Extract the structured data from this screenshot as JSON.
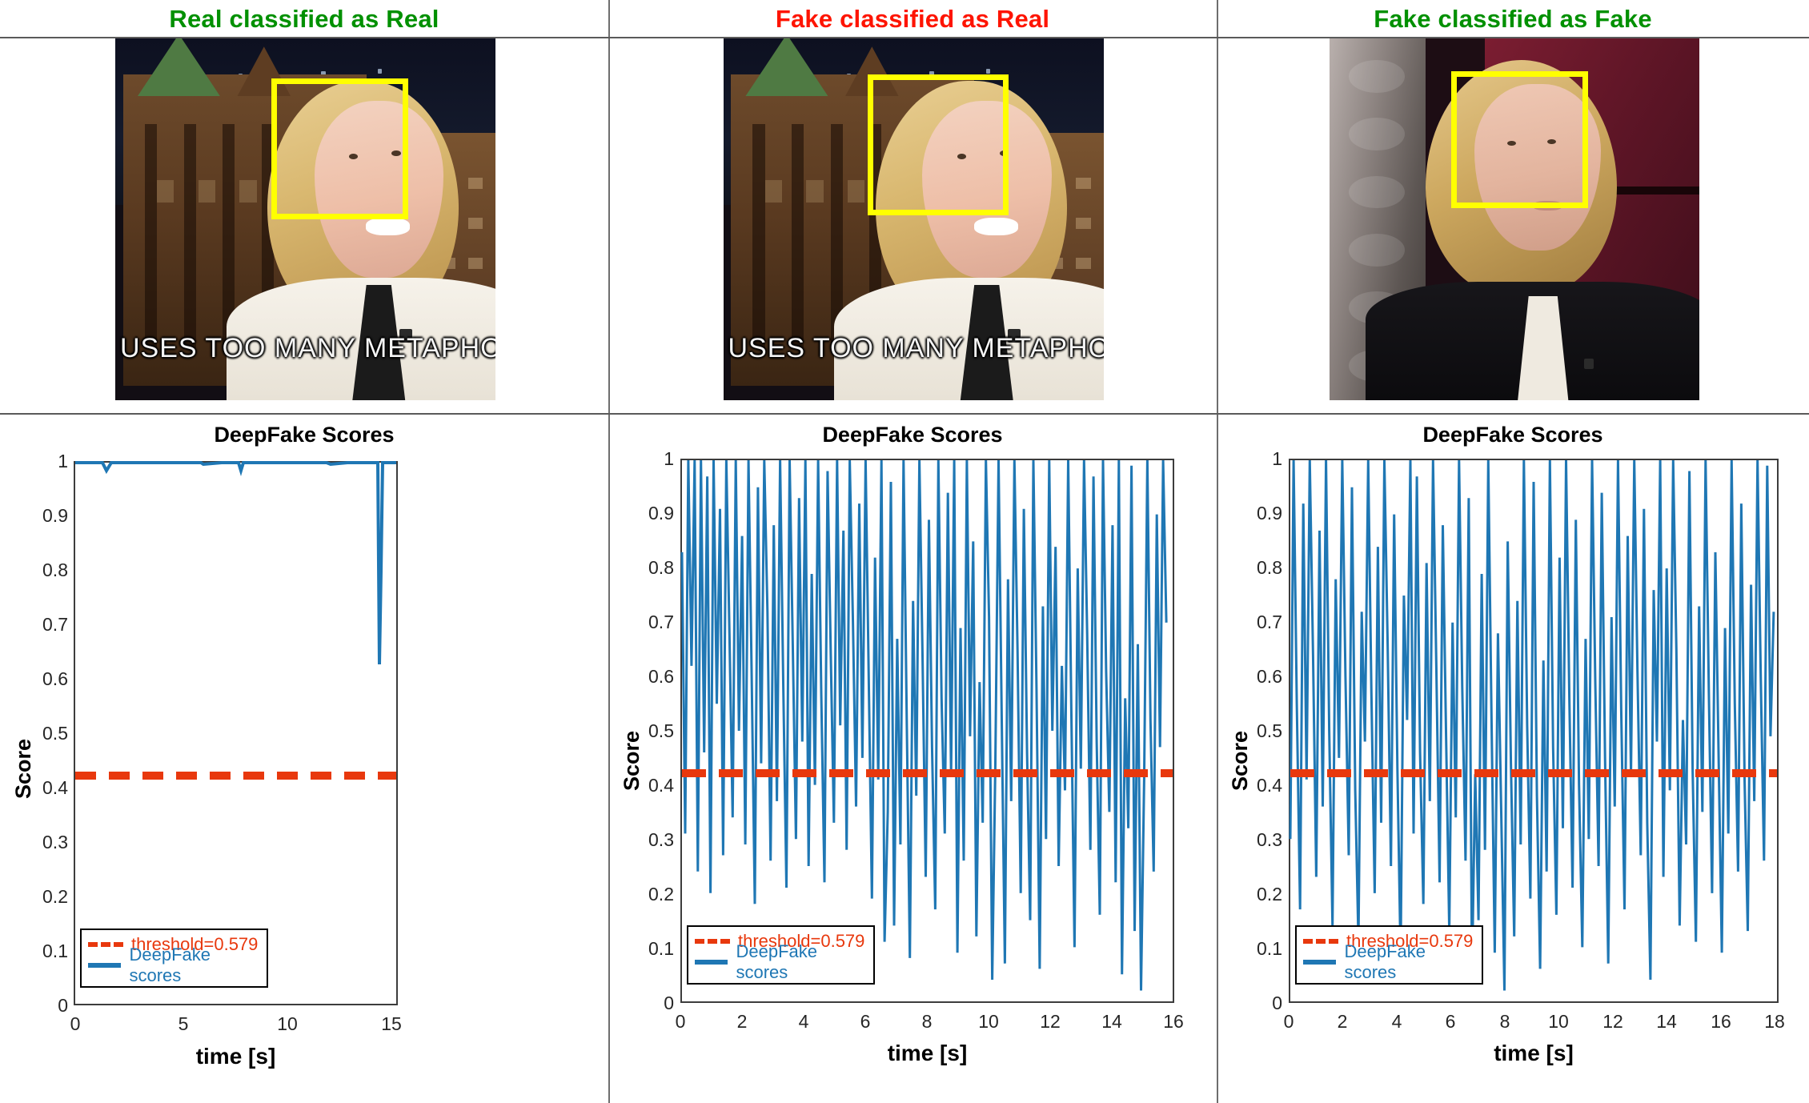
{
  "panels": [
    {
      "header": {
        "text": "Real classified as Real",
        "color": "#009000"
      },
      "caption": "USES TOO MANY METAPHO",
      "bbox_label": "face-bounding-box",
      "chart": {
        "title": "DeepFake Scores",
        "xlabel": "time [s]",
        "ylabel": "Score",
        "xticks": [
          "0",
          "5",
          "10",
          "15"
        ],
        "yticks": [
          "0",
          "0.1",
          "0.2",
          "0.3",
          "0.4",
          "0.5",
          "0.6",
          "0.7",
          "0.8",
          "0.9",
          "1"
        ],
        "legend": {
          "threshold": "threshold=0.579",
          "series": "DeepFake scores"
        }
      }
    },
    {
      "header": {
        "text": "Fake classified as Real",
        "color": "#fe1400"
      },
      "caption": "USES TOO MANY METAPHO",
      "bbox_label": "face-bounding-box",
      "chart": {
        "title": "DeepFake Scores",
        "xlabel": "time [s]",
        "ylabel": "Score",
        "xticks": [
          "0",
          "2",
          "4",
          "6",
          "8",
          "10",
          "12",
          "14",
          "16"
        ],
        "yticks": [
          "0",
          "0.1",
          "0.2",
          "0.3",
          "0.4",
          "0.5",
          "0.6",
          "0.7",
          "0.8",
          "0.9",
          "1"
        ],
        "legend": {
          "threshold": "threshold=0.579",
          "series": "DeepFake scores"
        }
      }
    },
    {
      "header": {
        "text": "Fake classified as Fake",
        "color": "#009000"
      },
      "caption": "",
      "bbox_label": "face-bounding-box",
      "chart": {
        "title": "DeepFake Scores",
        "xlabel": "time [s]",
        "ylabel": "Score",
        "xticks": [
          "0",
          "2",
          "4",
          "6",
          "8",
          "10",
          "12",
          "14",
          "16",
          "18"
        ],
        "yticks": [
          "0",
          "0.1",
          "0.2",
          "0.3",
          "0.4",
          "0.5",
          "0.6",
          "0.7",
          "0.8",
          "0.9",
          "1"
        ],
        "legend": {
          "threshold": "threshold=0.579",
          "series": "DeepFake scores"
        }
      }
    }
  ],
  "colors": {
    "series_blue": "#1f77b4",
    "threshold_red": "#e8380d",
    "bbox_yellow": "#ffff00",
    "header_green": "#009000",
    "header_red": "#fe1400"
  },
  "chart_data": [
    {
      "type": "line",
      "title": "DeepFake Scores",
      "xlabel": "time [s]",
      "ylabel": "Score",
      "xlim": [
        0,
        15.6
      ],
      "ylim": [
        0,
        1
      ],
      "xticks": [
        0,
        5,
        10,
        15
      ],
      "yticks": [
        0,
        0.1,
        0.2,
        0.3,
        0.4,
        0.5,
        0.6,
        0.7,
        0.8,
        0.9,
        1
      ],
      "grid": false,
      "legend": [
        "threshold=0.579",
        "DeepFake scores"
      ],
      "legend_position": "lower left",
      "threshold": 0.579,
      "series": [
        {
          "name": "DeepFake scores",
          "color": "#1f77b4",
          "x": [
            0,
            0.5,
            1.0,
            1.4,
            1.55,
            1.7,
            2.2,
            3.0,
            4.0,
            5.0,
            6.0,
            6.1,
            7.0,
            7.8,
            7.9,
            8.0,
            9.0,
            10.0,
            11.0,
            12.0,
            12.2,
            13.0,
            14.0,
            14.45,
            14.5,
            14.55,
            14.6,
            14.8,
            15.0,
            15.4
          ],
          "y": [
            1,
            1,
            1,
            1,
            0.985,
            1,
            1,
            1,
            1,
            1,
            1,
            0.998,
            1,
            1,
            0.985,
            1,
            1,
            1,
            1,
            1,
            0.997,
            1,
            1,
            1,
            0.63,
            0.8,
            1,
            1,
            1,
            1
          ]
        }
      ]
    },
    {
      "type": "line",
      "title": "DeepFake Scores",
      "xlabel": "time [s]",
      "ylabel": "Score",
      "xlim": [
        0,
        15.5
      ],
      "ylim": [
        0,
        1
      ],
      "xticks": [
        0,
        2,
        4,
        6,
        8,
        10,
        12,
        14,
        16
      ],
      "yticks": [
        0,
        0.1,
        0.2,
        0.3,
        0.4,
        0.5,
        0.6,
        0.7,
        0.8,
        0.9,
        1
      ],
      "grid": false,
      "legend": [
        "threshold=0.579",
        "DeepFake scores"
      ],
      "legend_position": "lower left",
      "threshold": 0.579,
      "description": "Highly oscillatory signal spanning the full 0-1 range, spending most time above the threshold with frequent deep drops toward 0.",
      "series": [
        {
          "name": "DeepFake scores",
          "color": "#1f77b4",
          "x": [
            0.0,
            0.1,
            0.2,
            0.3,
            0.4,
            0.5,
            0.6,
            0.7,
            0.8,
            0.9,
            1.0,
            1.1,
            1.2,
            1.3,
            1.4,
            1.5,
            1.6,
            1.7,
            1.8,
            1.9,
            2.0,
            2.1,
            2.2,
            2.3,
            2.4,
            2.5,
            2.6,
            2.7,
            2.8,
            2.9,
            3.0,
            3.1,
            3.2,
            3.3,
            3.4,
            3.5,
            3.6,
            3.7,
            3.8,
            3.9,
            4.0,
            4.1,
            4.2,
            4.3,
            4.4,
            4.5,
            4.6,
            4.7,
            4.8,
            4.9,
            5.0,
            5.1,
            5.2,
            5.3,
            5.4,
            5.5,
            5.6,
            5.7,
            5.8,
            5.9,
            6.0,
            6.1,
            6.2,
            6.3,
            6.4,
            6.5,
            6.6,
            6.7,
            6.8,
            6.9,
            7.0,
            7.1,
            7.2,
            7.3,
            7.4,
            7.5,
            7.6,
            7.7,
            7.8,
            7.9,
            8.0,
            8.1,
            8.2,
            8.3,
            8.4,
            8.5,
            8.6,
            8.7,
            8.8,
            8.9,
            9.0,
            9.1,
            9.2,
            9.3,
            9.4,
            9.5,
            9.6,
            9.7,
            9.8,
            9.9,
            10.0,
            10.1,
            10.2,
            10.3,
            10.4,
            10.5,
            10.6,
            10.7,
            10.8,
            10.9,
            11.0,
            11.1,
            11.2,
            11.3,
            11.4,
            11.5,
            11.6,
            11.7,
            11.8,
            11.9,
            12.0,
            12.1,
            12.2,
            12.3,
            12.4,
            12.5,
            12.6,
            12.7,
            12.8,
            12.9,
            13.0,
            13.1,
            13.2,
            13.3,
            13.4,
            13.5,
            13.6,
            13.7,
            13.8,
            13.9,
            14.0,
            14.1,
            14.2,
            14.3,
            14.4,
            14.5,
            14.6,
            14.7,
            14.8,
            14.9,
            15.0,
            15.1,
            15.2,
            15.3,
            15.4,
            15.5
          ],
          "y": [
            0.83,
            0.31,
            1.0,
            0.62,
            1.0,
            0.24,
            1.0,
            0.46,
            0.97,
            0.2,
            1.0,
            0.55,
            0.91,
            0.27,
            1.0,
            0.68,
            0.34,
            1.0,
            0.5,
            0.86,
            0.29,
            1.0,
            0.61,
            0.18,
            0.95,
            0.44,
            1.0,
            0.72,
            0.26,
            0.88,
            0.37,
            1.0,
            0.58,
            0.21,
            1.0,
            0.66,
            0.3,
            0.93,
            0.48,
            1.0,
            0.25,
            0.79,
            0.4,
            1.0,
            0.57,
            0.22,
            0.98,
            0.64,
            0.33,
            1.0,
            0.51,
            0.87,
            0.28,
            1.0,
            0.7,
            0.36,
            0.92,
            0.45,
            1.0,
            0.6,
            0.19,
            0.82,
            0.41,
            1.0,
            0.11,
            0.35,
            0.96,
            0.14,
            0.67,
            0.29,
            1.0,
            0.52,
            0.08,
            0.74,
            0.38,
            1.0,
            0.63,
            0.23,
            0.89,
            0.47,
            0.17,
            1.0,
            0.56,
            0.31,
            0.94,
            0.42,
            1.0,
            0.09,
            0.69,
            0.26,
            1.0,
            0.49,
            0.85,
            0.12,
            0.59,
            0.33,
            1.0,
            0.71,
            0.04,
            0.44,
            1.0,
            0.53,
            0.07,
            0.78,
            0.37,
            1.0,
            0.65,
            0.2,
            0.91,
            0.46,
            0.15,
            1.0,
            0.58,
            0.06,
            0.73,
            0.3,
            1.0,
            0.5,
            0.84,
            0.25,
            0.62,
            0.39,
            1.0,
            0.54,
            0.1,
            0.8,
            0.43,
            1.0,
            0.68,
            0.28,
            0.97,
            0.48,
            0.16,
            1.0,
            0.61,
            0.35,
            0.88,
            0.22,
            1.0,
            0.05,
            0.56,
            0.32,
            0.99,
            0.13,
            0.66,
            0.02,
            0.41,
            1.0,
            0.52,
            0.24,
            0.9,
            0.47,
            1.0,
            0.7
          ]
        }
      ]
    },
    {
      "type": "line",
      "title": "DeepFake Scores",
      "xlabel": "time [s]",
      "ylabel": "Score",
      "xlim": [
        0,
        18
      ],
      "ylim": [
        0,
        1
      ],
      "xticks": [
        0,
        2,
        4,
        6,
        8,
        10,
        12,
        14,
        16,
        18
      ],
      "yticks": [
        0,
        0.1,
        0.2,
        0.3,
        0.4,
        0.5,
        0.6,
        0.7,
        0.8,
        0.9,
        1
      ],
      "grid": false,
      "legend": [
        "threshold=0.579",
        "DeepFake scores"
      ],
      "legend_position": "lower left",
      "threshold": 0.579,
      "description": "Highly oscillatory signal spanning 0-1 over 18 seconds, with many excursions below the 0.579 threshold.",
      "series": [
        {
          "name": "DeepFake scores",
          "color": "#1f77b4",
          "x": [
            0.0,
            0.12,
            0.24,
            0.36,
            0.48,
            0.6,
            0.72,
            0.84,
            0.96,
            1.08,
            1.2,
            1.32,
            1.44,
            1.56,
            1.68,
            1.8,
            1.92,
            2.04,
            2.16,
            2.28,
            2.4,
            2.52,
            2.64,
            2.76,
            2.88,
            3.0,
            3.12,
            3.24,
            3.36,
            3.48,
            3.6,
            3.72,
            3.84,
            3.96,
            4.08,
            4.2,
            4.32,
            4.44,
            4.56,
            4.68,
            4.8,
            4.92,
            5.04,
            5.16,
            5.28,
            5.4,
            5.52,
            5.64,
            5.76,
            5.88,
            6.0,
            6.12,
            6.24,
            6.36,
            6.48,
            6.6,
            6.72,
            6.84,
            6.96,
            7.08,
            7.2,
            7.32,
            7.44,
            7.56,
            7.68,
            7.8,
            7.92,
            8.04,
            8.16,
            8.28,
            8.4,
            8.52,
            8.64,
            8.76,
            8.88,
            9.0,
            9.12,
            9.24,
            9.36,
            9.48,
            9.6,
            9.72,
            9.84,
            9.96,
            10.08,
            10.2,
            10.32,
            10.44,
            10.56,
            10.68,
            10.8,
            10.92,
            11.04,
            11.16,
            11.28,
            11.4,
            11.52,
            11.64,
            11.76,
            11.88,
            12.0,
            12.12,
            12.24,
            12.36,
            12.48,
            12.6,
            12.72,
            12.84,
            12.96,
            13.08,
            13.2,
            13.32,
            13.44,
            13.56,
            13.68,
            13.8,
            13.92,
            14.04,
            14.16,
            14.28,
            14.4,
            14.52,
            14.64,
            14.76,
            14.88,
            15.0,
            15.12,
            15.24,
            15.36,
            15.48,
            15.6,
            15.72,
            15.84,
            15.96,
            16.08,
            16.2,
            16.32,
            16.44,
            16.56,
            16.68,
            16.8,
            16.92,
            17.04,
            17.16,
            17.28,
            17.4,
            17.52,
            17.64,
            17.76,
            17.88,
            18.0
          ],
          "y": [
            0.3,
            1.0,
            0.55,
            0.17,
            0.92,
            0.41,
            1.0,
            0.64,
            0.23,
            0.87,
            0.36,
            1.0,
            0.5,
            0.14,
            0.78,
            0.45,
            1.0,
            0.6,
            0.27,
            0.95,
            0.39,
            0.11,
            0.72,
            0.48,
            1.0,
            0.57,
            0.2,
            0.84,
            0.33,
            1.0,
            0.66,
            0.25,
            0.9,
            0.43,
            0.08,
            0.75,
            0.52,
            1.0,
            0.31,
            0.97,
            0.46,
            0.18,
            0.81,
            0.37,
            1.0,
            0.62,
            0.22,
            0.88,
            0.49,
            0.13,
            0.7,
            0.34,
            1.0,
            0.58,
            0.26,
            0.93,
            0.05,
            0.42,
            0.15,
            0.79,
            0.28,
            1.0,
            0.53,
            0.09,
            0.68,
            0.35,
            0.02,
            0.85,
            0.44,
            0.12,
            0.74,
            0.29,
            1.0,
            0.51,
            0.19,
            0.96,
            0.38,
            0.06,
            0.63,
            0.24,
            1.0,
            0.47,
            0.16,
            0.82,
            0.32,
            1.0,
            0.56,
            0.21,
            0.89,
            0.4,
            0.1,
            0.67,
            0.3,
            1.0,
            0.59,
            0.25,
            0.94,
            0.45,
            0.07,
            0.71,
            0.36,
            1.0,
            0.54,
            0.17,
            0.86,
            0.42,
            1.0,
            0.61,
            0.27,
            0.91,
            0.33,
            0.04,
            0.76,
            0.48,
            1.0,
            0.23,
            0.8,
            0.39,
            1.0,
            0.65,
            0.14,
            0.52,
            0.29,
            0.98,
            0.43,
            0.11,
            0.73,
            0.35,
            1.0,
            0.57,
            0.2,
            0.83,
            0.46,
            0.09,
            0.69,
            0.31,
            1.0,
            0.55,
            0.24,
            0.92,
            0.41,
            0.13,
            0.77,
            0.37,
            1.0,
            0.6,
            0.26,
            0.99,
            0.49,
            0.72
          ]
        }
      ]
    }
  ]
}
